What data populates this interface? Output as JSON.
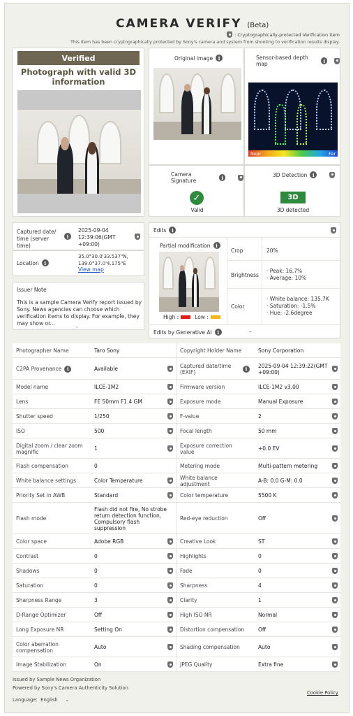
{
  "header": {
    "brand": "CAMERA VERIFY",
    "beta": "(Beta)",
    "crypto_note": ": Cryptographically-protected Verification Item",
    "sub_note": "This item has been cryptographically protected by Sony's camera and system from shooting to verification results display."
  },
  "summary": {
    "badge": "Verified",
    "title": "Photograph with valid 3D information"
  },
  "original_image": {
    "label": "Original image"
  },
  "depth_map": {
    "label": "Sensor-based depth map",
    "near": "Near",
    "far": "Far"
  },
  "camera_signature": {
    "label": "Camera Signature",
    "status": "Valid"
  },
  "detection_3d": {
    "label": "3D Detection",
    "badge": "3D",
    "status": "3D detected"
  },
  "captured": {
    "label": "Captured date/ time (server time)",
    "value": "2025-09-04 12:39:06(GMT +09:00)"
  },
  "location": {
    "label": "Location",
    "value": "35.0°30.0'33.537\"N, 139.0°37.0'4.175\"E",
    "link": "View map"
  },
  "issuer_note": {
    "label": "Issuer Note",
    "text": "This is a sample Camera Verify report issued by Sony. News agencies can choose which verification items to display. For example, they may show or..."
  },
  "edits": {
    "label": "Edits",
    "partial_label": "Partial modification",
    "legend_high": "High :",
    "legend_low": "Low :",
    "crop_label": "Crop",
    "crop_value": "20%",
    "brightness_label": "Brightness",
    "brightness_lines": [
      "· Peak: 16.7%",
      "· Average: 10%"
    ],
    "color_label": "Color",
    "color_lines": [
      "· White balance: 135.7K",
      "· Saturation: -1.5%",
      "· Hue: -2.6degree"
    ],
    "genai_label": "Edits by Generative AI",
    "genai_value": "–"
  },
  "table": [
    [
      "Photographer Name",
      "Taro Sony",
      false,
      "Copyright Holder Name",
      "Sony Corporation",
      false
    ],
    [
      "C2PA Provenance",
      "Available",
      true,
      "Captured date/time (EXIF)",
      "2025-09-04 12:39:22(GMT +09:00)",
      true
    ],
    [
      "Model name",
      "ILCE-1M2",
      true,
      "Firmware version",
      "ILCE-1M2 v3.00",
      true
    ],
    [
      "Lens",
      "FE 50mm F1.4 GM",
      true,
      "Exposure mode",
      "Manual Exposure",
      true
    ],
    [
      "Shutter speed",
      "1/250",
      true,
      "F-value",
      "2",
      true
    ],
    [
      "ISO",
      "500",
      true,
      "Focal length",
      "50 mm",
      true
    ],
    [
      "Digital zoom / clear zoom magnific",
      "1",
      true,
      "Exposure correction value",
      "+0.0 EV",
      true
    ],
    [
      "Flash compensation",
      "0",
      false,
      "Metering mode",
      "Multi-pattern metering",
      true
    ],
    [
      "White balance settings",
      "Color Temperature",
      true,
      "White balance adjustment",
      "A-B: 0.0 G-M: 0.0",
      true
    ],
    [
      "Priority Set in AWB",
      "Standard",
      true,
      "Color temperature",
      "5500 K",
      true
    ],
    [
      "Flash mode",
      "Flash did not fire, No strobe return detection function, Compulsory flash suppression",
      false,
      "Red-eye reduction",
      "Off",
      true
    ],
    [
      "Color space",
      "Adobe RGB",
      true,
      "Creative Look",
      "ST",
      true
    ],
    [
      "Contrast",
      "0",
      true,
      "Highlights",
      "0",
      true
    ],
    [
      "Shadows",
      "0",
      true,
      "Fade",
      "0",
      true
    ],
    [
      "Saturation",
      "0",
      true,
      "Sharpness",
      "4",
      true
    ],
    [
      "Sharpness Range",
      "3",
      true,
      "Clarity",
      "1",
      true
    ],
    [
      "D-Range Optimizer",
      "Off",
      true,
      "High ISO NR",
      "Normal",
      true
    ],
    [
      "Long Exposure NR",
      "Setting On",
      true,
      "Distortion compensation",
      "Off",
      true
    ],
    [
      "Color aberration compensation",
      "Auto",
      true,
      "Shading compensation",
      "Auto",
      true
    ],
    [
      "Image Stabilization",
      "On",
      true,
      "JPEG Quality",
      "Extra fine",
      true
    ]
  ],
  "footer": {
    "issued_by": "Issued by  Sample News Organization",
    "powered_by": "Powered by Sony's Camera Authenticity Solution",
    "language_label": "Language:",
    "language_value": "English",
    "cookie": "Cookie Policy"
  }
}
